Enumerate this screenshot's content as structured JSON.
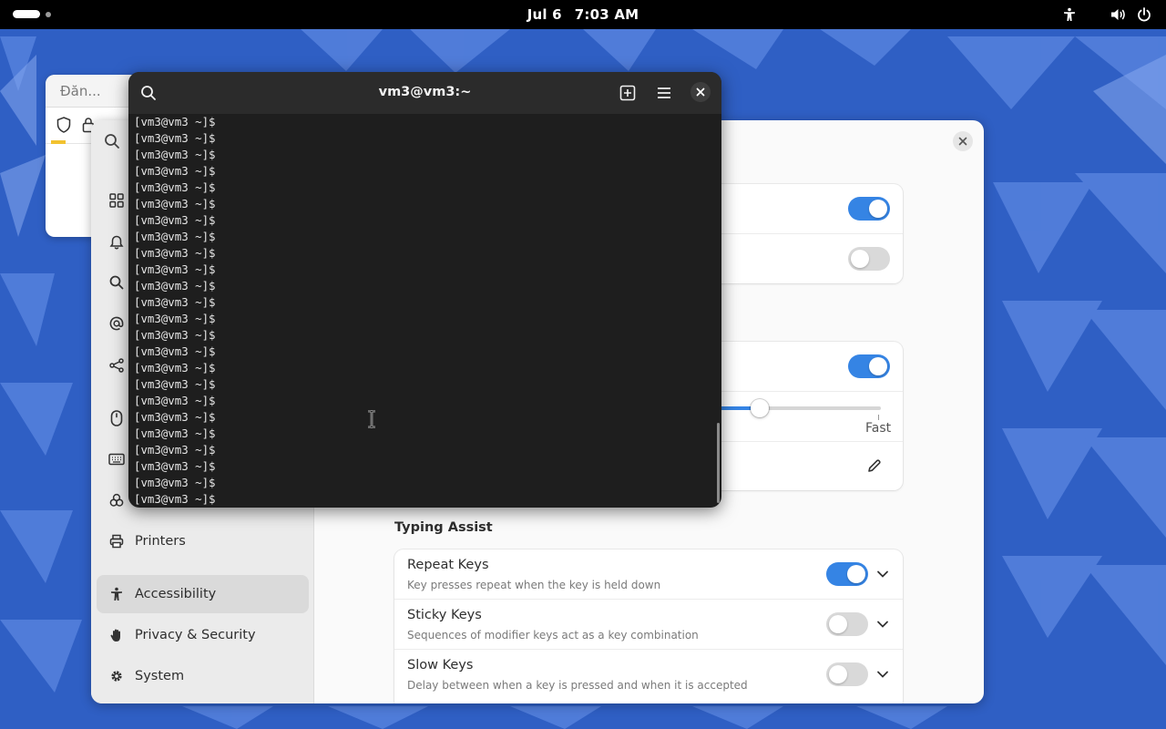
{
  "topbar": {
    "date": "Jul 6",
    "time": "7:03 AM"
  },
  "browser": {
    "tab_title": "Đăn..."
  },
  "terminal": {
    "title": "vm3@vm3:~",
    "prompt_lines": [
      "[vm3@vm3 ~]$",
      "[vm3@vm3 ~]$",
      "[vm3@vm3 ~]$",
      "[vm3@vm3 ~]$",
      "[vm3@vm3 ~]$",
      "[vm3@vm3 ~]$",
      "[vm3@vm3 ~]$",
      "[vm3@vm3 ~]$",
      "[vm3@vm3 ~]$",
      "[vm3@vm3 ~]$",
      "[vm3@vm3 ~]$",
      "[vm3@vm3 ~]$",
      "[vm3@vm3 ~]$",
      "[vm3@vm3 ~]$",
      "[vm3@vm3 ~]$",
      "[vm3@vm3 ~]$",
      "[vm3@vm3 ~]$",
      "[vm3@vm3 ~]$",
      "[vm3@vm3 ~]$",
      "[vm3@vm3 ~]$",
      "[vm3@vm3 ~]$",
      "[vm3@vm3 ~]$",
      "[vm3@vm3 ~]$",
      "[vm3@vm3 ~]$"
    ]
  },
  "settings": {
    "sidebar": {
      "printers": "Printers",
      "accessibility": "Accessibility",
      "privacy": "Privacy & Security",
      "system": "System"
    },
    "top_card": {
      "switch1_on": true,
      "switch2_on": false
    },
    "repeat_card": {
      "switch_on": true,
      "slider_fast_label": "Fast",
      "slider_value_fraction": 0.75
    },
    "typing_assist": {
      "title": "Typing Assist",
      "rows": [
        {
          "title": "Repeat Keys",
          "subtitle": "Key presses repeat when the key is held down",
          "on": true
        },
        {
          "title": "Sticky Keys",
          "subtitle": "Sequences of modifier keys act as a key combination",
          "on": false
        },
        {
          "title": "Slow Keys",
          "subtitle": "Delay between when a key is pressed and when it is accepted",
          "on": false
        }
      ]
    }
  },
  "colors": {
    "accent": "#3584e4",
    "wallpaper": "#2f5fc4"
  }
}
